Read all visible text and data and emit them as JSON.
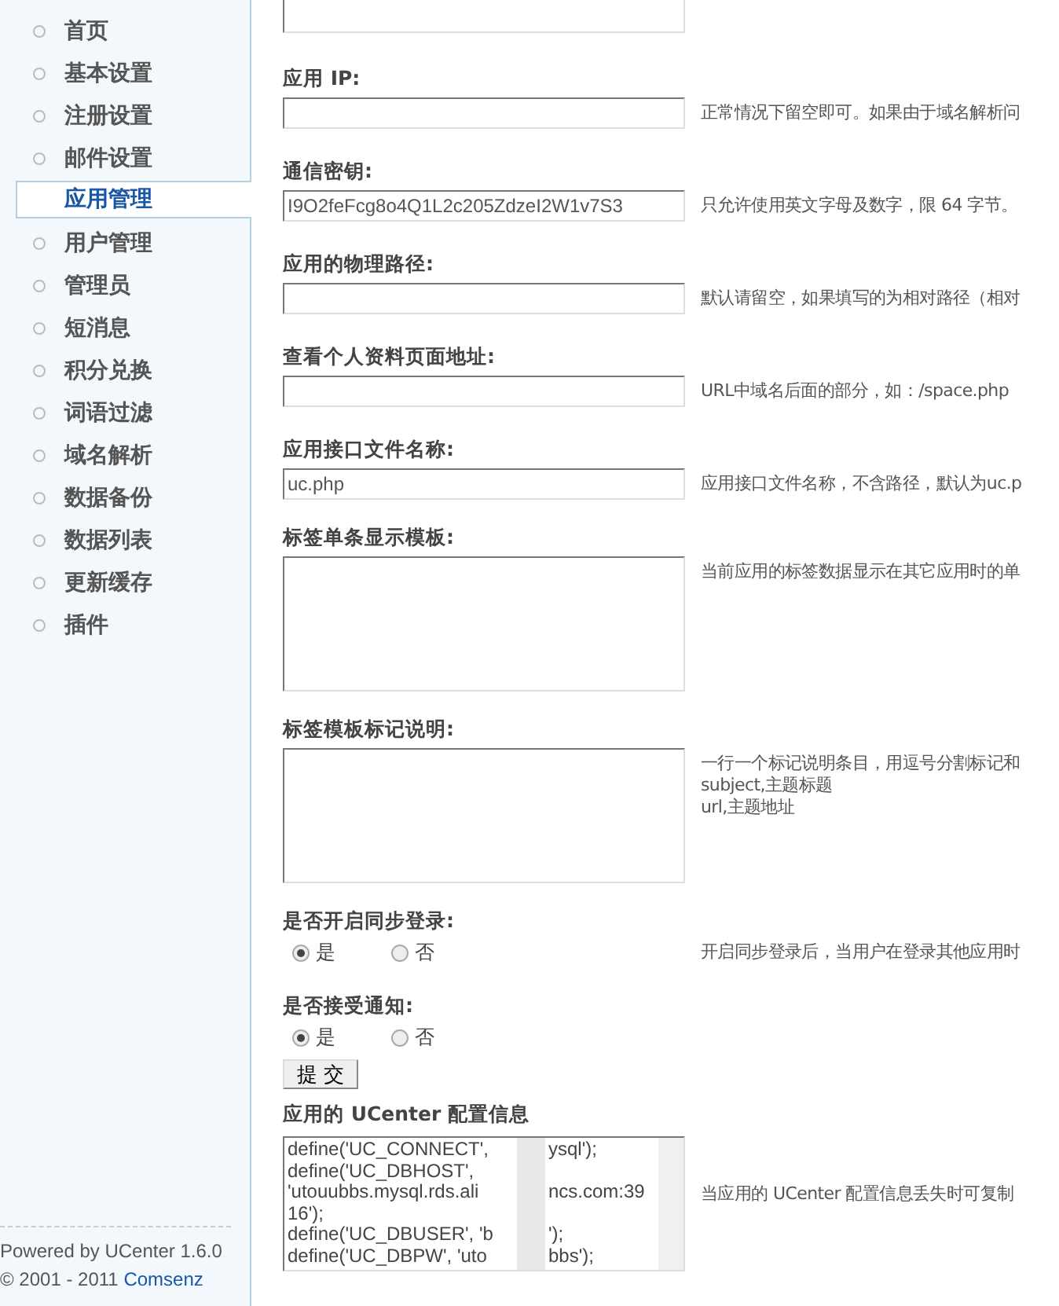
{
  "sidebar": {
    "items": [
      {
        "label": "首页",
        "selected": false
      },
      {
        "label": "基本设置",
        "selected": false
      },
      {
        "label": "注册设置",
        "selected": false
      },
      {
        "label": "邮件设置",
        "selected": false
      },
      {
        "label": "应用管理",
        "selected": true
      },
      {
        "label": "用户管理",
        "selected": false
      },
      {
        "label": "管理员",
        "selected": false
      },
      {
        "label": "短消息",
        "selected": false
      },
      {
        "label": "积分兑换",
        "selected": false
      },
      {
        "label": "词语过滤",
        "selected": false
      },
      {
        "label": "域名解析",
        "selected": false
      },
      {
        "label": "数据备份",
        "selected": false
      },
      {
        "label": "数据列表",
        "selected": false
      },
      {
        "label": "更新缓存",
        "selected": false
      },
      {
        "label": "插件",
        "selected": false
      }
    ],
    "footer": {
      "powered": "Powered by UCenter 1.6.0",
      "copyright": "© 2001 - 2011",
      "company": "Comsenz"
    }
  },
  "form": {
    "fields": [
      {
        "kind": "partial-textarea"
      },
      {
        "kind": "text",
        "label": "应用 IP:",
        "hint": "正常情况下留空即可。如果由于域名解析问"
      },
      {
        "kind": "text",
        "label": "通信密钥:",
        "value": "I9O2feFcg8o4Q1L2c205ZdzeI2W1v7S3",
        "hint": "只允许使用英文字母及数字，限 64 字节。"
      },
      {
        "kind": "text",
        "label": "应用的物理路径:",
        "hint": "默认请留空，如果填写的为相对路径（相对"
      },
      {
        "kind": "text",
        "label": "查看个人资料页面地址:",
        "hint": "URL中域名后面的部分，如：/space.php"
      },
      {
        "kind": "text",
        "label": "应用接口文件名称:",
        "value": "uc.php",
        "hint": "应用接口文件名称，不含路径，默认为uc.p"
      },
      {
        "kind": "textarea",
        "label": "标签单条显示模板:",
        "hint": "当前应用的标签数据显示在其它应用时的单"
      },
      {
        "kind": "textarea",
        "label": "标签模板标记说明:",
        "hint": "一行一个标记说明条目，用逗号分割标记和\nsubject,主题标题\nurl,主题地址"
      },
      {
        "kind": "radio",
        "label": "是否开启同步登录:",
        "options": [
          {
            "label": "是",
            "selected": true
          },
          {
            "label": "否",
            "selected": false
          }
        ],
        "hint": "开启同步登录后，当用户在登录其他应用时"
      },
      {
        "kind": "radio",
        "label": "是否接受通知:",
        "options": [
          {
            "label": "是",
            "selected": true
          },
          {
            "label": "否",
            "selected": false
          }
        ]
      },
      {
        "kind": "submit",
        "label": "提 交"
      },
      {
        "kind": "code",
        "label": "应用的 UCenter 配置信息",
        "lines": [
          {
            "left": "define('UC_CONNECT',",
            "right": "ysql');"
          },
          {
            "left": "define('UC_DBHOST',"
          },
          {
            "left": "'utouubbs.mysql.rds.ali",
            "right": "ncs.com:39"
          },
          {
            "left": "16');"
          },
          {
            "left": "define('UC_DBUSER', 'b",
            "right": "');"
          },
          {
            "left": "define('UC_DBPW', 'uto",
            "right": "bbs');"
          }
        ],
        "hint": "当应用的 UCenter 配置信息丢失时可复制"
      }
    ]
  }
}
